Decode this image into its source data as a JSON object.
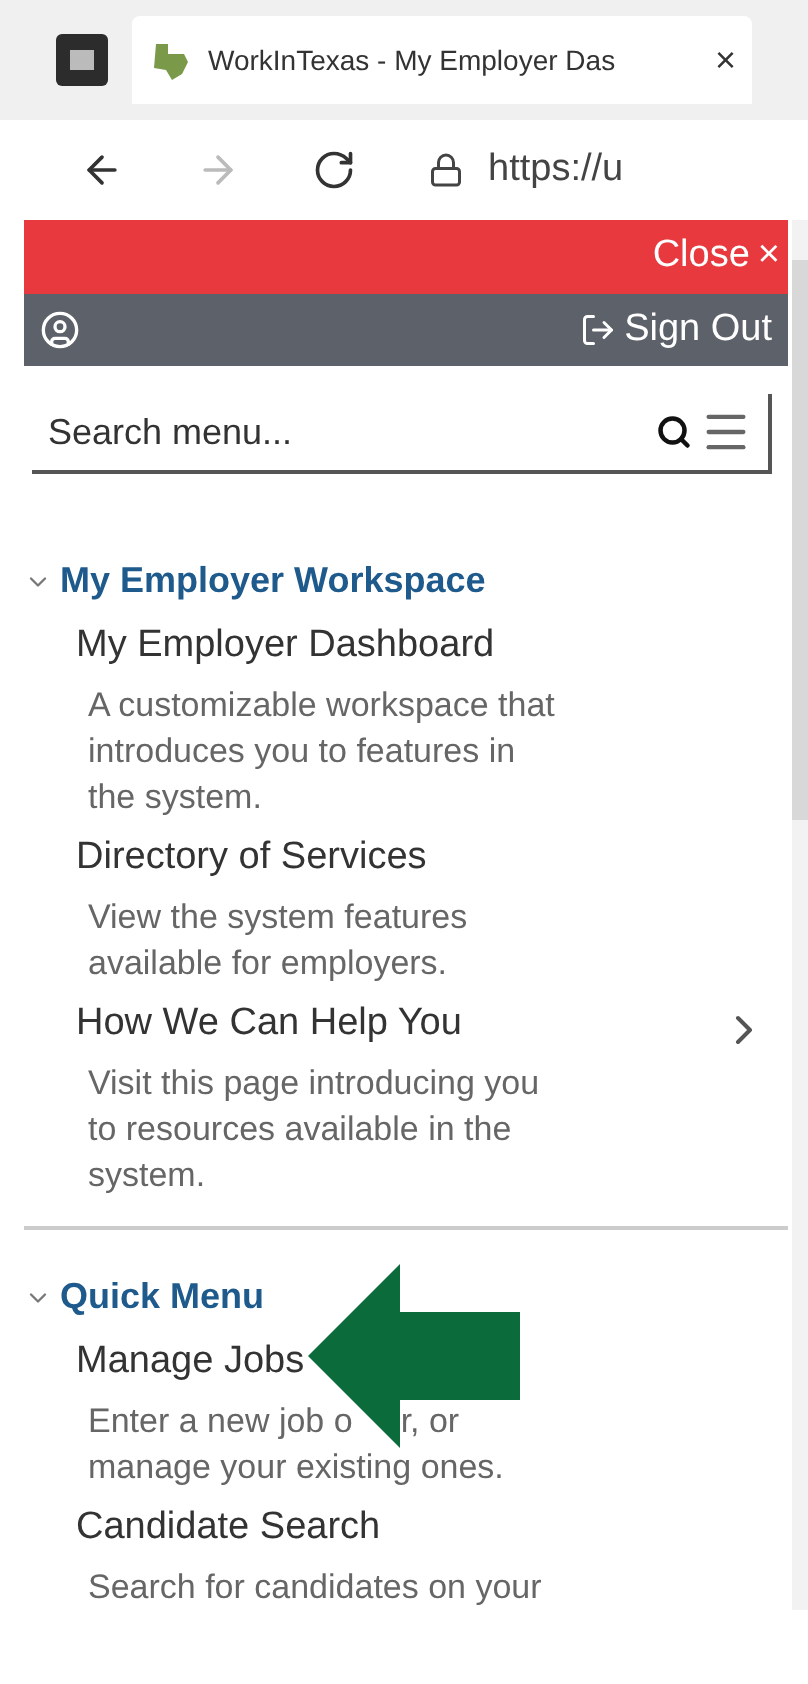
{
  "browser": {
    "tab_title": "WorkInTexas - My Employer Das",
    "tab_close": "×",
    "url": "https://u"
  },
  "panel": {
    "close": "Close",
    "close_icon": "×",
    "sign_out": "Sign Out"
  },
  "search": {
    "placeholder": "Search menu..."
  },
  "sections": [
    {
      "title": "My Employer Workspace",
      "expanded": true,
      "items": [
        {
          "label": "My Employer Dashboard",
          "description": [
            [
              "A customizable workspace that"
            ],
            [
              "introduces you to features in"
            ],
            [
              "the system."
            ]
          ],
          "has_submenu": false
        },
        {
          "label": "Directory of Services",
          "description": [
            [
              "View the system features"
            ],
            [
              "available for employers."
            ]
          ],
          "has_submenu": false
        },
        {
          "label": "How We Can Help You",
          "description": [
            [
              "Visit this page introducing you"
            ],
            [
              "to resources available in the"
            ],
            [
              "system."
            ]
          ],
          "has_submenu": true
        }
      ]
    },
    {
      "title": "Quick Menu",
      "expanded": true,
      "items": [
        {
          "label": "Manage Jobs",
          "description": [
            [
              "Enter a new job o",
              "r, or"
            ],
            [
              "manage your existing ones."
            ]
          ],
          "has_submenu": false
        },
        {
          "label": "Candidate Search",
          "description": [
            [
              "Search for candidates on your"
            ]
          ],
          "has_submenu": false
        }
      ]
    }
  ]
}
